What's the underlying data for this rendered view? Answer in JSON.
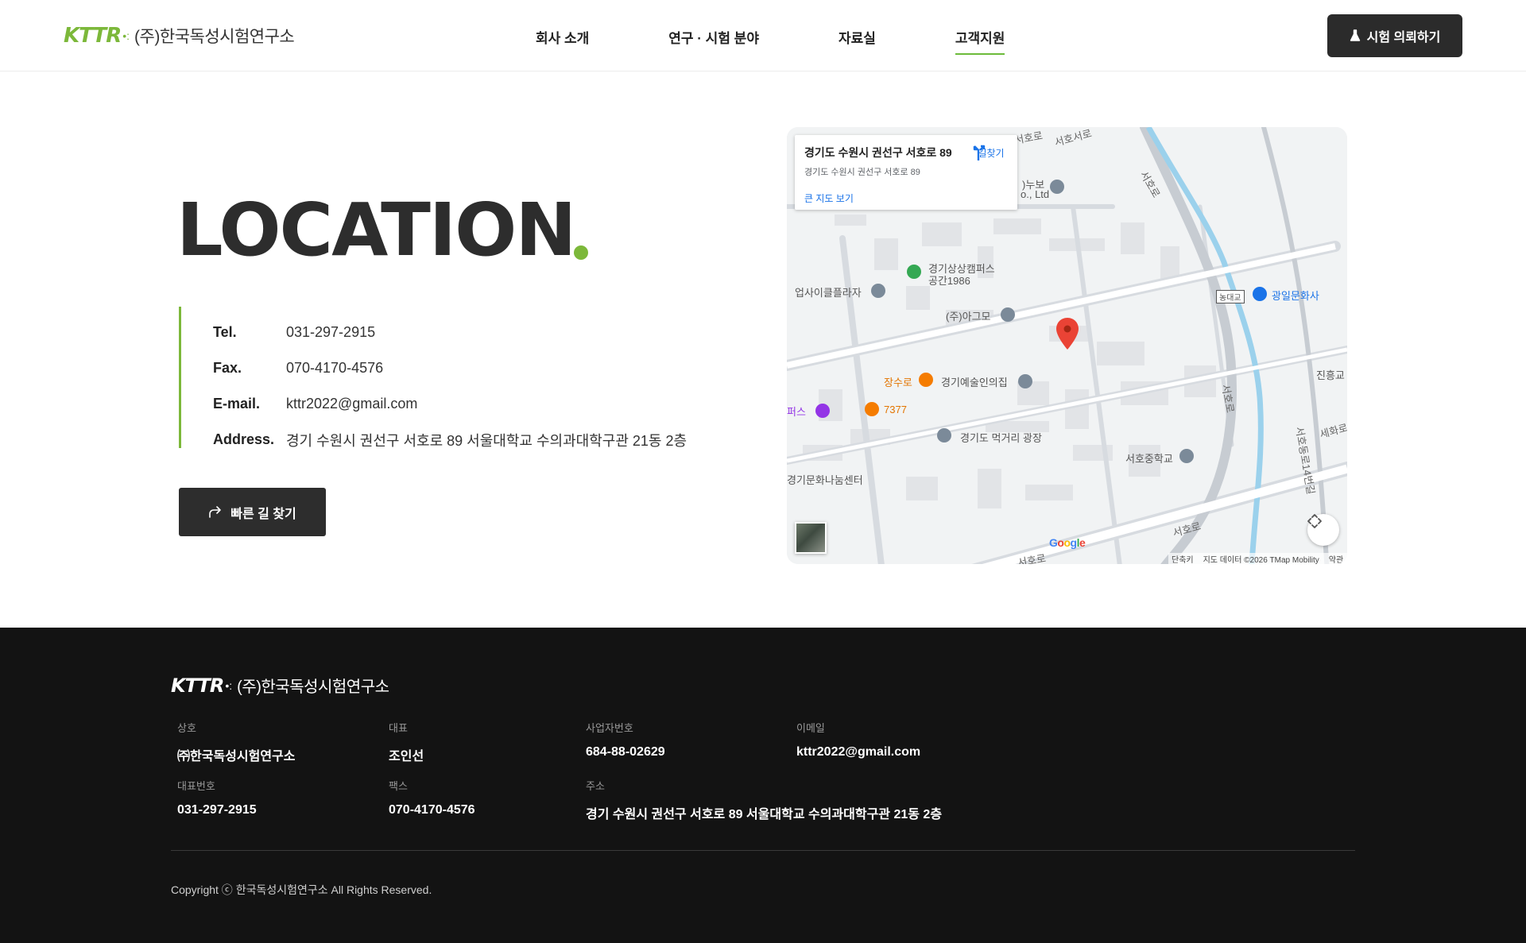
{
  "header": {
    "logo_mark": "KTTR",
    "logo_text": "(주)한국독성시험연구소",
    "nav": [
      {
        "label": "회사 소개"
      },
      {
        "label": "연구 · 시험 분야"
      },
      {
        "label": "자료실"
      },
      {
        "label": "고객지원"
      }
    ],
    "active_nav": "고객지원",
    "cta_label": "시험 의뢰하기"
  },
  "location": {
    "title": "LOCATION",
    "rows": [
      {
        "label": "Tel.",
        "value": "031-297-2915"
      },
      {
        "label": "Fax.",
        "value": "070-4170-4576"
      },
      {
        "label": "E-mail.",
        "value": "kttr2022@gmail.com"
      },
      {
        "label": "Address.",
        "value": "경기 수원시 권선구 서호로 89 서울대학교 수의과대학구관 21동 2층"
      }
    ],
    "route_button": "빠른 길 찾기"
  },
  "map": {
    "card_title": "경기도 수원시 권선구 서호로 89",
    "card_subtitle": "경기도 수원시 권선구 서호로 89",
    "directions_label": "길찾기",
    "larger_map_link": "큰 지도 보기",
    "labels": {
      "p1": "경기상상캠퍼스",
      "p1b": "공간1986",
      "p2": "업사이클플라자",
      "p3": "(주)아그모",
      "p4": "장수로",
      "p5": "경기예술인의집",
      "p6": "7377",
      "p7": "경기도 먹거리 광장",
      "p8": "서호중학교",
      "p9": "경기문화나눔센터",
      "p10": "광일문화사",
      "p11": "진흥교",
      "p12": "세화로",
      "p13": "농대교",
      "p14": "퍼스",
      "p15": ")누보",
      "p16": "o., Ltd",
      "r1": "서호로",
      "r2": "서호로",
      "r3": "서호로",
      "r4": "서호로",
      "r5": "서호동로14번길",
      "r6": "서호서로",
      "r7": "서호로"
    },
    "google": "Google",
    "attribution": [
      "단축키",
      "지도 데이터 ©2026 TMap Mobility",
      "약관"
    ]
  },
  "footer": {
    "logo_mark": "KTTR",
    "logo_text": "(주)한국독성시험연구소",
    "fields": [
      {
        "label": "상호",
        "value": "㈜한국독성시험연구소"
      },
      {
        "label": "대표",
        "value": "조인선"
      },
      {
        "label": "사업자번호",
        "value": "684-88-02629"
      },
      {
        "label": "이메일",
        "value": "kttr2022@gmail.com"
      },
      {
        "label": "대표번호",
        "value": "031-297-2915"
      },
      {
        "label": "팩스",
        "value": "070-4170-4576"
      },
      {
        "label": "주소",
        "value": "경기 수원시 권선구 서호로 89 서울대학교 수의과대학구관 21동 2층"
      }
    ],
    "copyright": "Copyright ⓒ 한국독성시험연구소 All Rights Reserved."
  },
  "colors": {
    "accent_green": "#7cb83a",
    "dark": "#2d2d2d",
    "footer_bg": "#131313",
    "map_pin": "#ea4335"
  },
  "icons": [
    "flask-icon",
    "share-arrow-icon",
    "directions-icon",
    "map-pin-icon",
    "fullscreen-icon"
  ]
}
